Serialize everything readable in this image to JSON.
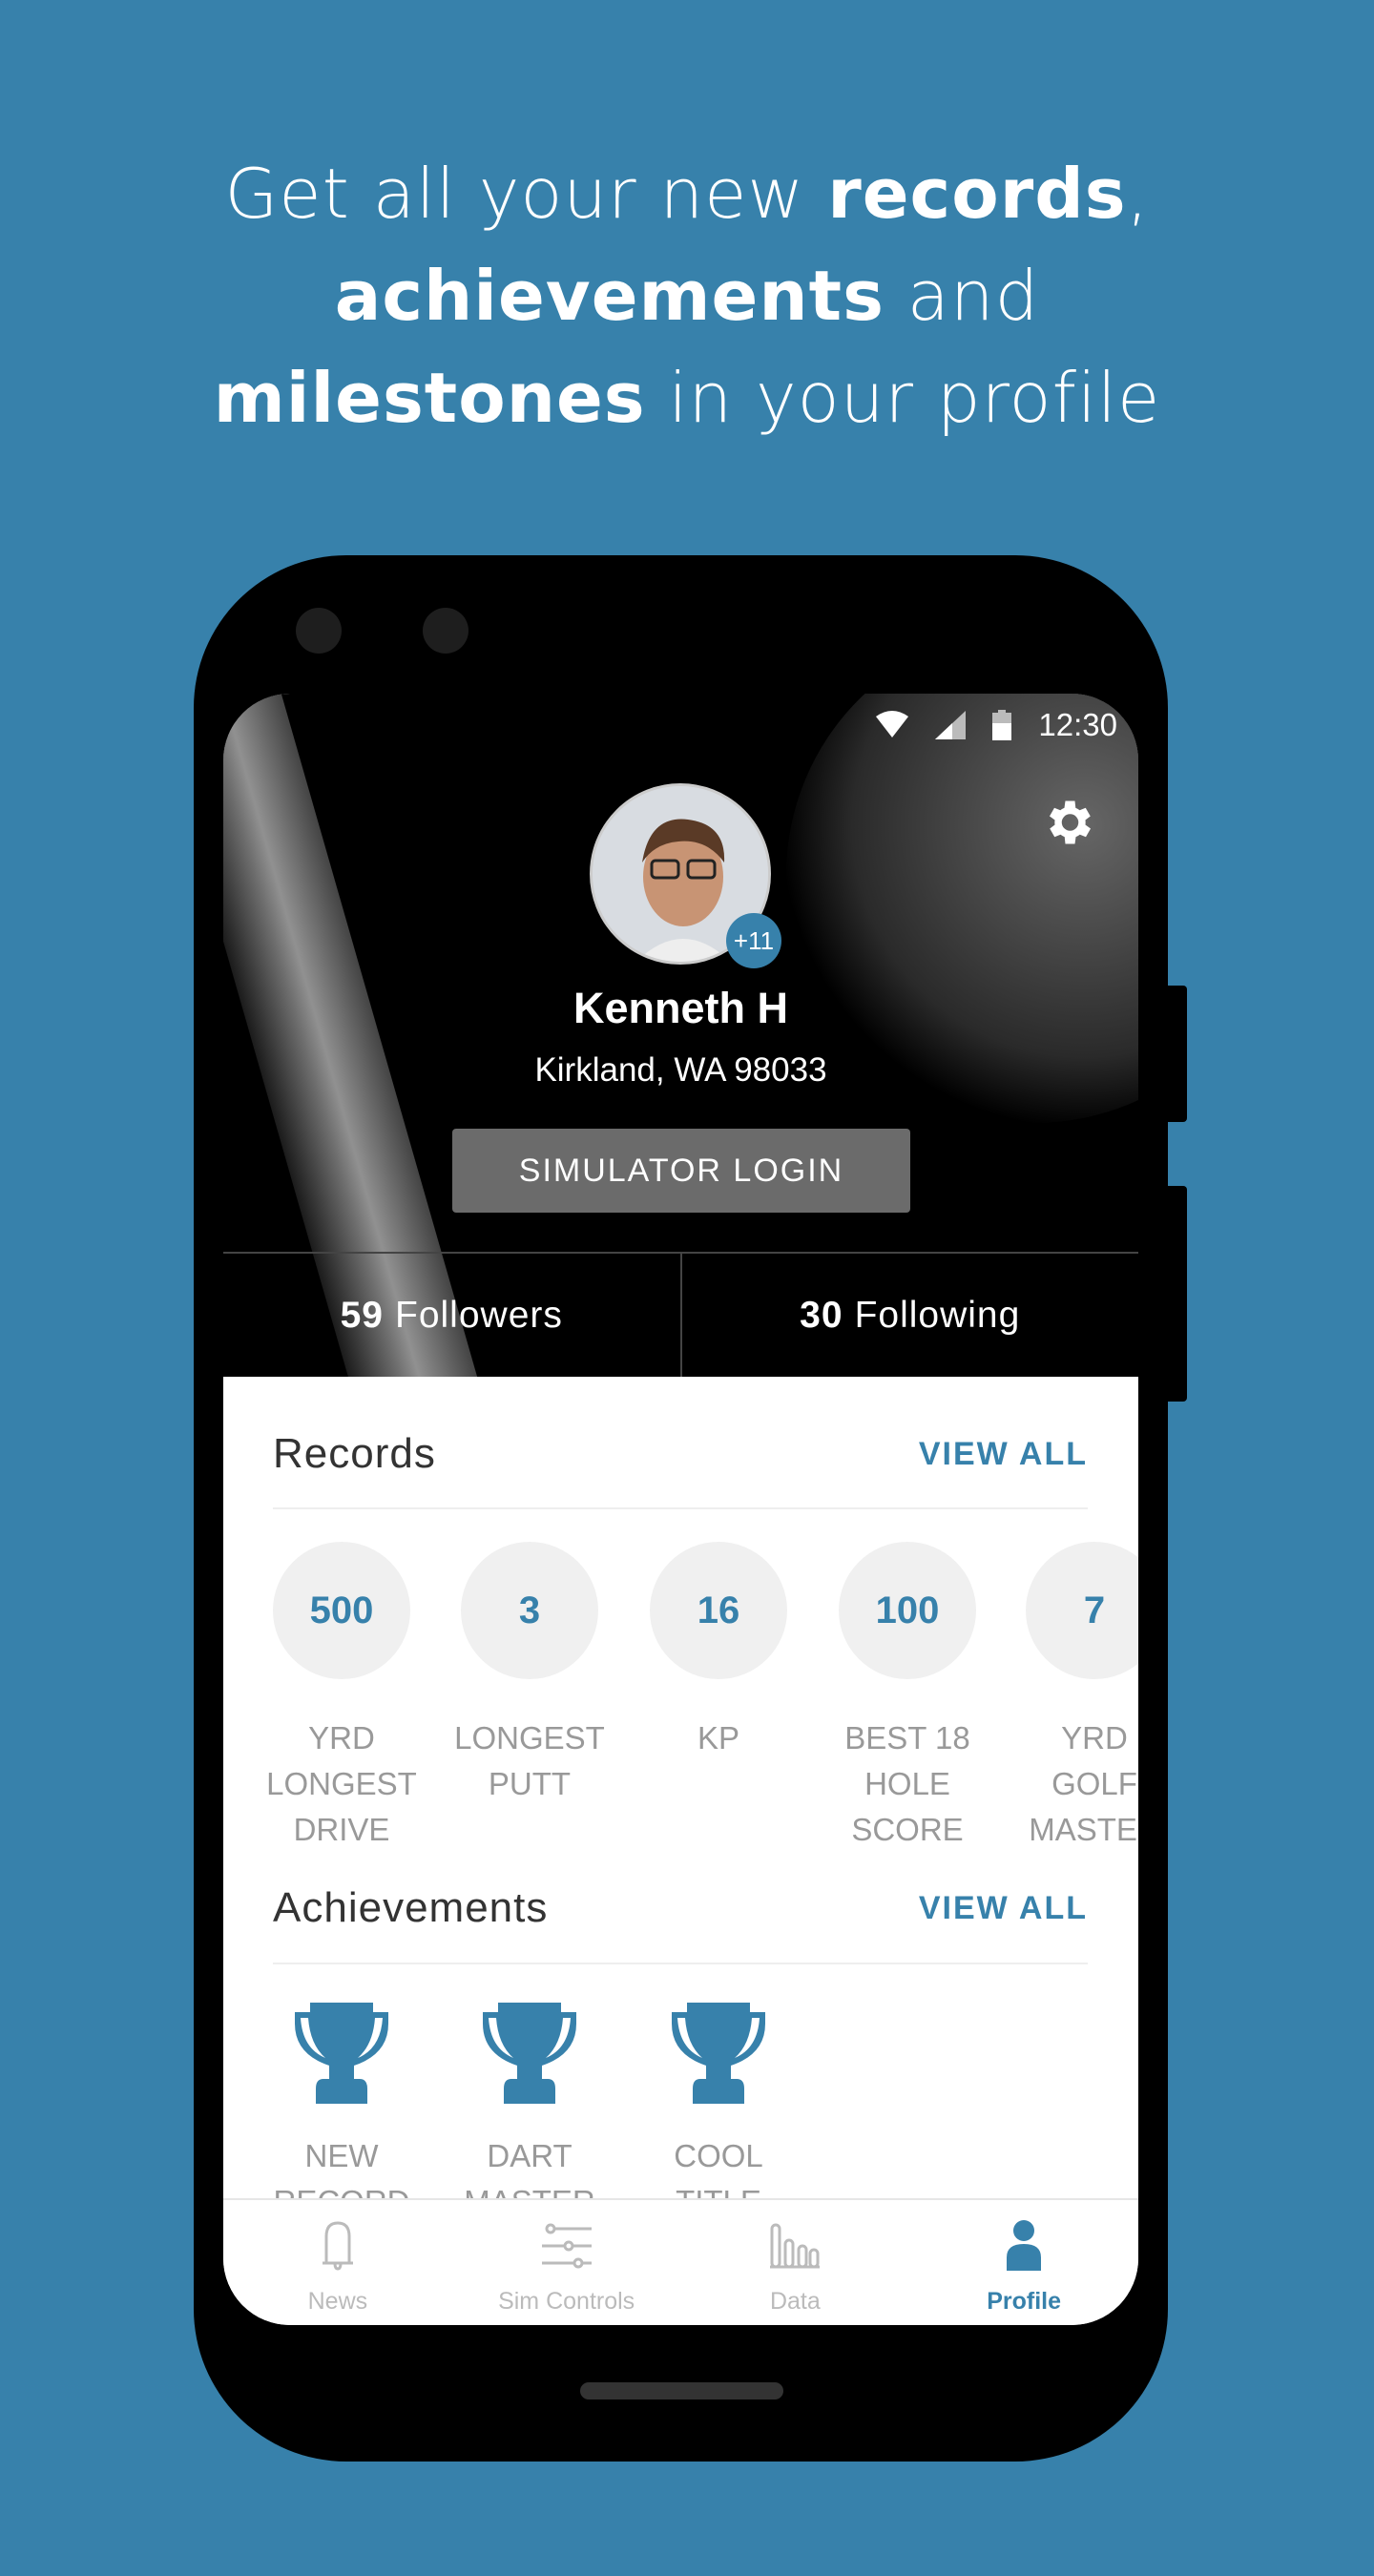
{
  "headline": {
    "l1a": "Get all your new ",
    "l1b": "records",
    "l1c": ",",
    "l2a": "achievements",
    "l2b": " and",
    "l3a": "milestones",
    "l3b": " in your profile"
  },
  "colors": {
    "background": "#3781ab",
    "accent": "#3781ab"
  },
  "status_bar": {
    "time": "12:30",
    "icons": [
      "wifi-icon",
      "signal-icon",
      "battery-icon"
    ]
  },
  "profile": {
    "name": "Kenneth H",
    "location": "Kirkland, WA 98033",
    "badge": "+11",
    "simulator_login": "SIMULATOR LOGIN",
    "followers_count": "59",
    "followers_label": "Followers",
    "following_count": "30",
    "following_label": "Following"
  },
  "records": {
    "title": "Records",
    "view_all": "VIEW ALL",
    "items": [
      {
        "value": "500",
        "label": [
          "YRD",
          "LONGEST",
          "DRIVE"
        ]
      },
      {
        "value": "3",
        "label": [
          "LONGEST",
          "PUTT",
          ""
        ]
      },
      {
        "value": "16",
        "label": [
          "KP",
          "",
          ""
        ]
      },
      {
        "value": "100",
        "label": [
          "BEST 18",
          "HOLE",
          "SCORE"
        ]
      },
      {
        "value": "7",
        "label": [
          "YRD",
          "GOLF",
          "MASTER"
        ]
      }
    ]
  },
  "achievements": {
    "title": "Achievements",
    "view_all": "VIEW ALL",
    "items": [
      {
        "label": [
          "NEW",
          "RECORD"
        ]
      },
      {
        "label": [
          "DART",
          "MASTER"
        ]
      },
      {
        "label": [
          "COOL",
          "TITLE"
        ]
      }
    ]
  },
  "tabs": [
    {
      "label": "News",
      "icon": "bell-icon"
    },
    {
      "label": "Sim Controls",
      "icon": "sliders-icon"
    },
    {
      "label": "Data",
      "icon": "bar-chart-icon"
    },
    {
      "label": "Profile",
      "icon": "person-icon",
      "active": true
    }
  ]
}
